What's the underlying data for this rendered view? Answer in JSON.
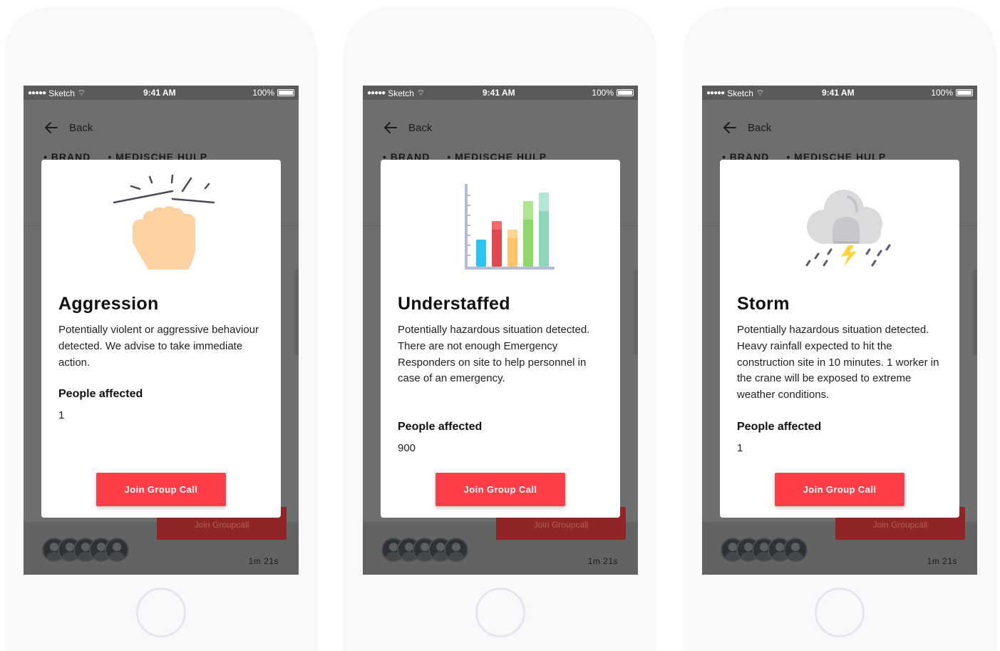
{
  "status_bar": {
    "carrier": "Sketch",
    "time": "9:41 AM",
    "battery": "100%"
  },
  "nav": {
    "back_label": "Back"
  },
  "chips": [
    "BRAND",
    "MEDISCHE HULP"
  ],
  "background_call": {
    "join_label": "Join Groupcall",
    "duration": "1m 21s"
  },
  "alerts": [
    {
      "title": "Aggression",
      "description": "Potentially violent or aggressive behaviour detected. We advise to take immediate action.",
      "people_label": "People affected",
      "people_value": "1",
      "button_label": "Join Group Call",
      "icon": "raised-fist-icon"
    },
    {
      "title": "Understaffed",
      "description": "Potentially hazardous situation detected. There are not enough Emergency Responders on site to help personnel in case of an emergency.",
      "people_label": "People affected",
      "people_value": "900",
      "button_label": "Join Group Call",
      "icon": "bar-chart-icon"
    },
    {
      "title": "Storm",
      "description": "Potentially hazardous situation detected. Heavy rainfall expected to hit the construction site in 10 minutes. 1 worker in the crane will be exposed to extreme weather conditions.",
      "people_label": "People affected",
      "people_value": "1",
      "button_label": "Join Group Call",
      "icon": "storm-cloud-icon"
    }
  ],
  "colors": {
    "accent": "#fe3e48",
    "overlay": "#6e6e6e",
    "bar_blue": "#29c4f0",
    "bar_red": "#e04a4f",
    "bar_orange": "#ffc36a",
    "bar_green": "#8fd86c",
    "bar_teal": "#8ed6b9"
  }
}
